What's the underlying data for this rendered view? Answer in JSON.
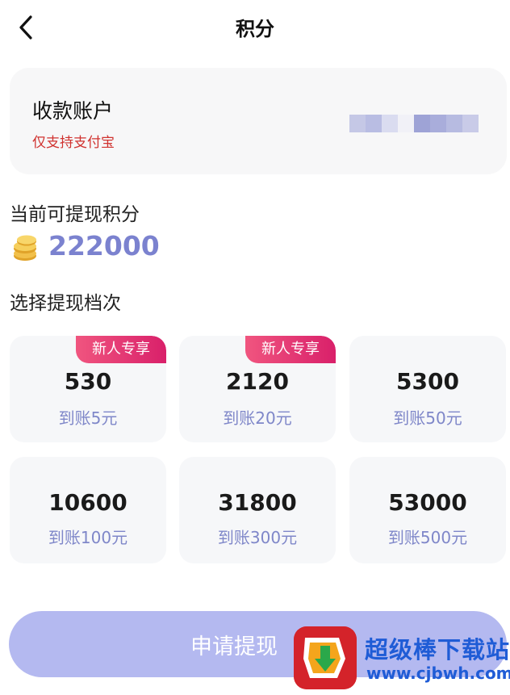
{
  "header": {
    "title": "积分"
  },
  "account": {
    "title": "收款账户",
    "subtitle": "仅支持支付宝"
  },
  "balance": {
    "label": "当前可提现积分",
    "value": "222000"
  },
  "tiers_label": "选择提现档次",
  "tiers": [
    {
      "points": "530",
      "amount": "到账5元",
      "badge": "新人专享"
    },
    {
      "points": "2120",
      "amount": "到账20元",
      "badge": "新人专享"
    },
    {
      "points": "5300",
      "amount": "到账50元"
    },
    {
      "points": "10600",
      "amount": "到账100元"
    },
    {
      "points": "31800",
      "amount": "到账300元"
    },
    {
      "points": "53000",
      "amount": "到账500元"
    }
  ],
  "apply_button": {
    "label": "申请提现"
  },
  "watermark": {
    "name": "超级棒下载站",
    "url": "www.cjbwh.com"
  },
  "colors": {
    "accent": "#7b82cf",
    "button": "#b4b9f0",
    "badge": "#e0326f",
    "alert": "#d0322f"
  }
}
